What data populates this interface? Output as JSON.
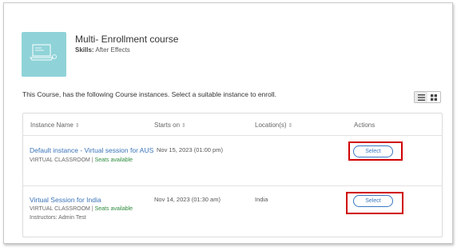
{
  "course": {
    "title": "Multi- Enrollment course",
    "skills_label": "Skills:",
    "skills_value": "After Effects",
    "thumbnail_icon": "laptop-icon"
  },
  "intro_text": "This Course, has the following Course instances. Select a suitable instance to enroll.",
  "view_toggle": {
    "active": "list",
    "icons": [
      "list-view-icon",
      "grid-view-icon"
    ]
  },
  "table": {
    "headers": {
      "instance_name": "Instance Name",
      "starts_on": "Starts on",
      "locations": "Location(s)",
      "actions": "Actions"
    },
    "rows": [
      {
        "name": "Default instance - Virtual session for AUS",
        "type": "VIRTUAL CLASSROOM",
        "separator": "|",
        "seats": "Seats available",
        "instructors": "",
        "starts_on": "Nov 15, 2023 (01:00 pm)",
        "location": "",
        "action": "Select"
      },
      {
        "name": "Virtual Session for India",
        "type": "VIRTUAL CLASSROOM",
        "separator": "|",
        "seats": "Seats available",
        "instructors": "Instructors: Admin Test",
        "starts_on": "Nov 14, 2023 (01:30 am)",
        "location": "India",
        "action": "Select"
      }
    ]
  },
  "colors": {
    "link": "#3973b8",
    "seats": "#2e8b3e",
    "button": "#3a78c2",
    "highlight": "#d00000",
    "thumbnail": "#8fd3d8"
  }
}
